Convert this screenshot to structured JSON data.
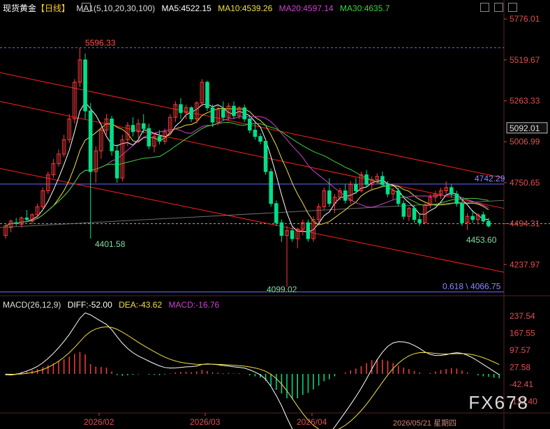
{
  "header": {
    "instrument": "现货黄金",
    "period": "【日线】",
    "ma_label": "MA1(5,10,20,30,100)",
    "ma5": "MA5:4522.15",
    "ma10": "MA10:4539.26",
    "ma20": "MA20:4597.14",
    "ma30": "MA30:4635.7"
  },
  "macd_header": {
    "label": "MACD(26,12,9)",
    "diff": "DIFF:-52.00",
    "dea": "DEA:-43.62",
    "macd": "MACD:-16.76"
  },
  "colors": {
    "up": "#ff3b3b",
    "down": "#00e08a",
    "ma5": "#ffffff",
    "ma10": "#f0e040",
    "ma20": "#d040d0",
    "ma30": "#40d040",
    "ma100": "#888888",
    "channel": "#ff2020",
    "hline": "#6a6aff",
    "dashed": "#ff9a30"
  },
  "annotations": {
    "high": "5596.33",
    "low1": "4401.58",
    "low2": "4099.02",
    "low3": "4453.60",
    "level": "4742.29",
    "fib": "0.618 \\ 4066.75",
    "last_price": "5092.01",
    "dashed_level": "4494.31"
  },
  "watermark": "FX678",
  "cursor_date": "2026/05/21 星期四",
  "chart_data": [
    {
      "type": "candlestick",
      "title": "现货黄金【日线】",
      "y_ticks": [
        "5776.01",
        "5519.67",
        "5263.33",
        "5006.99",
        "4750.65",
        "4494.31",
        "4237.97"
      ],
      "x_ticks": [
        "2026/02",
        "2026/03",
        "2026/04"
      ],
      "ylim": [
        4060,
        5790
      ],
      "series": [
        {
          "name": "MA5",
          "value": 4522.15
        },
        {
          "name": "MA10",
          "value": 4539.26
        },
        {
          "name": "MA20",
          "value": 4597.14
        },
        {
          "name": "MA30",
          "value": 4635.7
        }
      ],
      "candles": [
        [
          4420,
          4490,
          4400,
          4480
        ],
        [
          4470,
          4520,
          4440,
          4510
        ],
        [
          4500,
          4530,
          4480,
          4495
        ],
        [
          4490,
          4540,
          4470,
          4530
        ],
        [
          4530,
          4580,
          4510,
          4520
        ],
        [
          4510,
          4560,
          4490,
          4550
        ],
        [
          4550,
          4620,
          4530,
          4600
        ],
        [
          4600,
          4720,
          4580,
          4700
        ],
        [
          4700,
          4820,
          4680,
          4800
        ],
        [
          4800,
          4900,
          4780,
          4870
        ],
        [
          4870,
          4960,
          4850,
          4930
        ],
        [
          4930,
          5050,
          4910,
          5020
        ],
        [
          5020,
          5180,
          5000,
          5150
        ],
        [
          5150,
          5400,
          5120,
          5380
        ],
        [
          5380,
          5596,
          5350,
          5520
        ],
        [
          5520,
          5560,
          5150,
          5200
        ],
        [
          5200,
          5250,
          4401,
          4820
        ],
        [
          4820,
          4980,
          4750,
          4950
        ],
        [
          4950,
          5100,
          4900,
          5080
        ],
        [
          5080,
          5180,
          5050,
          5150
        ],
        [
          5150,
          5170,
          4920,
          4950
        ],
        [
          4950,
          4990,
          4750,
          4780
        ],
        [
          4780,
          5050,
          4760,
          5020
        ],
        [
          5020,
          5130,
          4980,
          5110
        ],
        [
          5110,
          5160,
          5040,
          5070
        ],
        [
          5070,
          5150,
          5030,
          5120
        ],
        [
          5120,
          5180,
          5060,
          5090
        ],
        [
          5090,
          5120,
          4960,
          4980
        ],
        [
          4980,
          5060,
          4940,
          5040
        ],
        [
          5040,
          5080,
          4990,
          5010
        ],
        [
          5010,
          5090,
          4990,
          5070
        ],
        [
          5070,
          5180,
          5050,
          5160
        ],
        [
          5160,
          5260,
          5130,
          5240
        ],
        [
          5240,
          5280,
          5150,
          5190
        ],
        [
          5190,
          5240,
          5150,
          5220
        ],
        [
          5220,
          5230,
          5130,
          5150
        ],
        [
          5150,
          5260,
          5120,
          5250
        ],
        [
          5250,
          5400,
          5230,
          5380
        ],
        [
          5380,
          5390,
          5200,
          5220
        ],
        [
          5220,
          5240,
          5100,
          5130
        ],
        [
          5130,
          5230,
          5110,
          5210
        ],
        [
          5210,
          5260,
          5140,
          5160
        ],
        [
          5160,
          5250,
          5140,
          5230
        ],
        [
          5230,
          5260,
          5150,
          5170
        ],
        [
          5170,
          5230,
          5150,
          5220
        ],
        [
          5220,
          5240,
          5130,
          5150
        ],
        [
          5150,
          5170,
          5060,
          5080
        ],
        [
          5080,
          5120,
          5020,
          5040
        ],
        [
          5040,
          5060,
          4990,
          5010
        ],
        [
          5010,
          5020,
          4800,
          4820
        ],
        [
          4820,
          4840,
          4600,
          4620
        ],
        [
          4620,
          4640,
          4480,
          4500
        ],
        [
          4500,
          4520,
          4380,
          4420
        ],
        [
          4420,
          4480,
          4100,
          4450
        ],
        [
          4450,
          4470,
          4380,
          4400
        ],
        [
          4400,
          4470,
          4340,
          4460
        ],
        [
          4460,
          4520,
          4420,
          4500
        ],
        [
          4500,
          4520,
          4380,
          4400
        ],
        [
          4400,
          4540,
          4380,
          4520
        ],
        [
          4520,
          4620,
          4500,
          4600
        ],
        [
          4600,
          4720,
          4580,
          4700
        ],
        [
          4700,
          4780,
          4600,
          4620
        ],
        [
          4620,
          4680,
          4560,
          4660
        ],
        [
          4660,
          4720,
          4640,
          4700
        ],
        [
          4700,
          4740,
          4620,
          4640
        ],
        [
          4640,
          4760,
          4620,
          4740
        ],
        [
          4740,
          4780,
          4680,
          4700
        ],
        [
          4700,
          4820,
          4690,
          4800
        ],
        [
          4800,
          4830,
          4720,
          4740
        ],
        [
          4740,
          4790,
          4700,
          4770
        ],
        [
          4770,
          4810,
          4740,
          4790
        ],
        [
          4790,
          4820,
          4720,
          4740
        ],
        [
          4740,
          4760,
          4660,
          4680
        ],
        [
          4680,
          4720,
          4640,
          4700
        ],
        [
          4700,
          4720,
          4600,
          4620
        ],
        [
          4620,
          4640,
          4520,
          4540
        ],
        [
          4540,
          4600,
          4510,
          4590
        ],
        [
          4590,
          4610,
          4500,
          4520
        ],
        [
          4520,
          4560,
          4480,
          4500
        ],
        [
          4500,
          4620,
          4490,
          4610
        ],
        [
          4610,
          4680,
          4590,
          4660
        ],
        [
          4660,
          4700,
          4630,
          4680
        ],
        [
          4680,
          4720,
          4650,
          4700
        ],
        [
          4700,
          4760,
          4680,
          4720
        ],
        [
          4720,
          4740,
          4660,
          4680
        ],
        [
          4680,
          4700,
          4600,
          4620
        ],
        [
          4620,
          4640,
          4480,
          4500
        ],
        [
          4500,
          4560,
          4454,
          4540
        ],
        [
          4540,
          4580,
          4500,
          4520
        ],
        [
          4520,
          4560,
          4490,
          4550
        ],
        [
          4550,
          4570,
          4500,
          4510
        ],
        [
          4510,
          4530,
          4470,
          4480
        ]
      ]
    },
    {
      "type": "bar",
      "title": "MACD(26,12,9)",
      "y_ticks": [
        "237.54",
        "167.55",
        "97.57",
        "27.58",
        "-42.41",
        "-112.40"
      ],
      "ylim": [
        -160,
        260
      ],
      "histogram": [
        -5,
        -2,
        3,
        8,
        12,
        15,
        20,
        28,
        36,
        44,
        52,
        60,
        70,
        82,
        90,
        80,
        40,
        30,
        28,
        26,
        10,
        -5,
        -8,
        -6,
        -4,
        -2,
        0,
        -3,
        -4,
        -5,
        -3,
        2,
        6,
        8,
        9,
        7,
        10,
        16,
        12,
        6,
        5,
        3,
        4,
        2,
        3,
        1,
        -6,
        -10,
        -15,
        -28,
        -48,
        -66,
        -80,
        -100,
        -104,
        -100,
        -86,
        -78,
        -64,
        -48,
        -30,
        -22,
        -10,
        0,
        6,
        14,
        22,
        32,
        44,
        56,
        60,
        58,
        54,
        44,
        34,
        26,
        20,
        12,
        6,
        0,
        4,
        10,
        16,
        20,
        24,
        22,
        14,
        6,
        0,
        -6,
        -10,
        -12,
        -16,
        -18
      ],
      "diff_line_end": -52.0,
      "dea_line_end": -43.62
    }
  ]
}
